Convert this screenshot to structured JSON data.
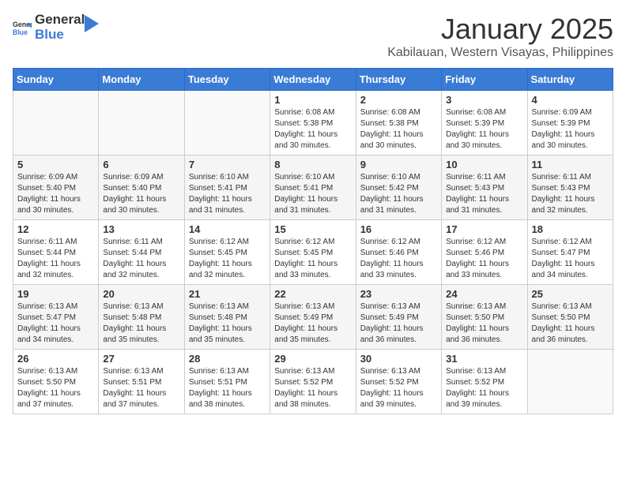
{
  "header": {
    "logo_general": "General",
    "logo_blue": "Blue",
    "month_title": "January 2025",
    "subtitle": "Kabilauan, Western Visayas, Philippines"
  },
  "days_of_week": [
    "Sunday",
    "Monday",
    "Tuesday",
    "Wednesday",
    "Thursday",
    "Friday",
    "Saturday"
  ],
  "weeks": [
    [
      {
        "day": "",
        "info": ""
      },
      {
        "day": "",
        "info": ""
      },
      {
        "day": "",
        "info": ""
      },
      {
        "day": "1",
        "info": "Sunrise: 6:08 AM\nSunset: 5:38 PM\nDaylight: 11 hours\nand 30 minutes."
      },
      {
        "day": "2",
        "info": "Sunrise: 6:08 AM\nSunset: 5:38 PM\nDaylight: 11 hours\nand 30 minutes."
      },
      {
        "day": "3",
        "info": "Sunrise: 6:08 AM\nSunset: 5:39 PM\nDaylight: 11 hours\nand 30 minutes."
      },
      {
        "day": "4",
        "info": "Sunrise: 6:09 AM\nSunset: 5:39 PM\nDaylight: 11 hours\nand 30 minutes."
      }
    ],
    [
      {
        "day": "5",
        "info": "Sunrise: 6:09 AM\nSunset: 5:40 PM\nDaylight: 11 hours\nand 30 minutes."
      },
      {
        "day": "6",
        "info": "Sunrise: 6:09 AM\nSunset: 5:40 PM\nDaylight: 11 hours\nand 30 minutes."
      },
      {
        "day": "7",
        "info": "Sunrise: 6:10 AM\nSunset: 5:41 PM\nDaylight: 11 hours\nand 31 minutes."
      },
      {
        "day": "8",
        "info": "Sunrise: 6:10 AM\nSunset: 5:41 PM\nDaylight: 11 hours\nand 31 minutes."
      },
      {
        "day": "9",
        "info": "Sunrise: 6:10 AM\nSunset: 5:42 PM\nDaylight: 11 hours\nand 31 minutes."
      },
      {
        "day": "10",
        "info": "Sunrise: 6:11 AM\nSunset: 5:43 PM\nDaylight: 11 hours\nand 31 minutes."
      },
      {
        "day": "11",
        "info": "Sunrise: 6:11 AM\nSunset: 5:43 PM\nDaylight: 11 hours\nand 32 minutes."
      }
    ],
    [
      {
        "day": "12",
        "info": "Sunrise: 6:11 AM\nSunset: 5:44 PM\nDaylight: 11 hours\nand 32 minutes."
      },
      {
        "day": "13",
        "info": "Sunrise: 6:11 AM\nSunset: 5:44 PM\nDaylight: 11 hours\nand 32 minutes."
      },
      {
        "day": "14",
        "info": "Sunrise: 6:12 AM\nSunset: 5:45 PM\nDaylight: 11 hours\nand 32 minutes."
      },
      {
        "day": "15",
        "info": "Sunrise: 6:12 AM\nSunset: 5:45 PM\nDaylight: 11 hours\nand 33 minutes."
      },
      {
        "day": "16",
        "info": "Sunrise: 6:12 AM\nSunset: 5:46 PM\nDaylight: 11 hours\nand 33 minutes."
      },
      {
        "day": "17",
        "info": "Sunrise: 6:12 AM\nSunset: 5:46 PM\nDaylight: 11 hours\nand 33 minutes."
      },
      {
        "day": "18",
        "info": "Sunrise: 6:12 AM\nSunset: 5:47 PM\nDaylight: 11 hours\nand 34 minutes."
      }
    ],
    [
      {
        "day": "19",
        "info": "Sunrise: 6:13 AM\nSunset: 5:47 PM\nDaylight: 11 hours\nand 34 minutes."
      },
      {
        "day": "20",
        "info": "Sunrise: 6:13 AM\nSunset: 5:48 PM\nDaylight: 11 hours\nand 35 minutes."
      },
      {
        "day": "21",
        "info": "Sunrise: 6:13 AM\nSunset: 5:48 PM\nDaylight: 11 hours\nand 35 minutes."
      },
      {
        "day": "22",
        "info": "Sunrise: 6:13 AM\nSunset: 5:49 PM\nDaylight: 11 hours\nand 35 minutes."
      },
      {
        "day": "23",
        "info": "Sunrise: 6:13 AM\nSunset: 5:49 PM\nDaylight: 11 hours\nand 36 minutes."
      },
      {
        "day": "24",
        "info": "Sunrise: 6:13 AM\nSunset: 5:50 PM\nDaylight: 11 hours\nand 36 minutes."
      },
      {
        "day": "25",
        "info": "Sunrise: 6:13 AM\nSunset: 5:50 PM\nDaylight: 11 hours\nand 36 minutes."
      }
    ],
    [
      {
        "day": "26",
        "info": "Sunrise: 6:13 AM\nSunset: 5:50 PM\nDaylight: 11 hours\nand 37 minutes."
      },
      {
        "day": "27",
        "info": "Sunrise: 6:13 AM\nSunset: 5:51 PM\nDaylight: 11 hours\nand 37 minutes."
      },
      {
        "day": "28",
        "info": "Sunrise: 6:13 AM\nSunset: 5:51 PM\nDaylight: 11 hours\nand 38 minutes."
      },
      {
        "day": "29",
        "info": "Sunrise: 6:13 AM\nSunset: 5:52 PM\nDaylight: 11 hours\nand 38 minutes."
      },
      {
        "day": "30",
        "info": "Sunrise: 6:13 AM\nSunset: 5:52 PM\nDaylight: 11 hours\nand 39 minutes."
      },
      {
        "day": "31",
        "info": "Sunrise: 6:13 AM\nSunset: 5:52 PM\nDaylight: 11 hours\nand 39 minutes."
      },
      {
        "day": "",
        "info": ""
      }
    ]
  ]
}
